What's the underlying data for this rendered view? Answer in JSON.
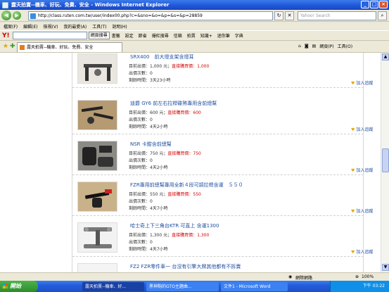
{
  "window": {
    "title": "露天拍賣--機車、好玩、免費、安全 - Windows Internet Explorer",
    "minimize": "_",
    "maximize": "□",
    "close": "×"
  },
  "address": {
    "url": "http://class.ruten.com.tw/user/index00.php?c=&sno=&o=&p=&s=&p=28859",
    "search_placeholder": "Yahoo! Search"
  },
  "menu": [
    "檔案(F)",
    "編輯(E)",
    "檢視(V)",
    "我的最愛(A)",
    "工具(T)",
    "說明(H)"
  ],
  "yahoo_toolbar": {
    "logo": "Y!",
    "search_button": "網頁搜尋",
    "items": [
      "書籤",
      "設定",
      "節省",
      "爆紅搜尋",
      "信箱",
      "拍賣",
      "知識+",
      "迷你筆",
      "字典"
    ]
  },
  "tab": {
    "label": "露天拍賣--機車、好玩、免費、安全"
  },
  "tab_commands": [
    "網頁(P)",
    "工具(O)"
  ],
  "listing_labels": {
    "price": "目前出價：",
    "direct": "直接購買價：",
    "bids": "出價次數：",
    "remaining": "剩餘時間：",
    "watch": "加入追蹤"
  },
  "listings": [
    {
      "title": "SRX400　前大燈支架含燈耳",
      "price": "1,000 元",
      "buy_now": "1,000",
      "bids": "0",
      "remaining": "3天23小時"
    },
    {
      "title": "迪爵 GY6 前左右拉桿碟煞專用含前總幫",
      "price": "600 元",
      "buy_now": "600",
      "bids": "0",
      "remaining": "4天2小時"
    },
    {
      "title": "NSR 卡鉗含前總幫",
      "price": "750 元",
      "buy_now": "750",
      "bids": "0",
      "remaining": "4天2小時"
    },
    {
      "title": "FZR專用前總幫專用全新４段可調拉桿含運　５５０",
      "price": "550 元",
      "buy_now": "550",
      "bids": "0",
      "remaining": "4天7小時"
    },
    {
      "title": "哈士奇上下三角台KTR 可直上 含運1300",
      "price": "1,300 元",
      "buy_now": "1,300",
      "bids": "0",
      "remaining": "4天7小時"
    },
    {
      "title": "FZ2 FZR零件車一 台沒有引擎大牌其他都有不拆賣"
    }
  ],
  "status": {
    "zone": "網際網路",
    "zoom": "100%"
  },
  "taskbar": {
    "start": "開始",
    "tasks": [
      "露天拍賣--機車、好...",
      "黑神駒的GTO主題曲...",
      "文件1 - Microsoft Word"
    ],
    "clock": "下午 03:22"
  }
}
